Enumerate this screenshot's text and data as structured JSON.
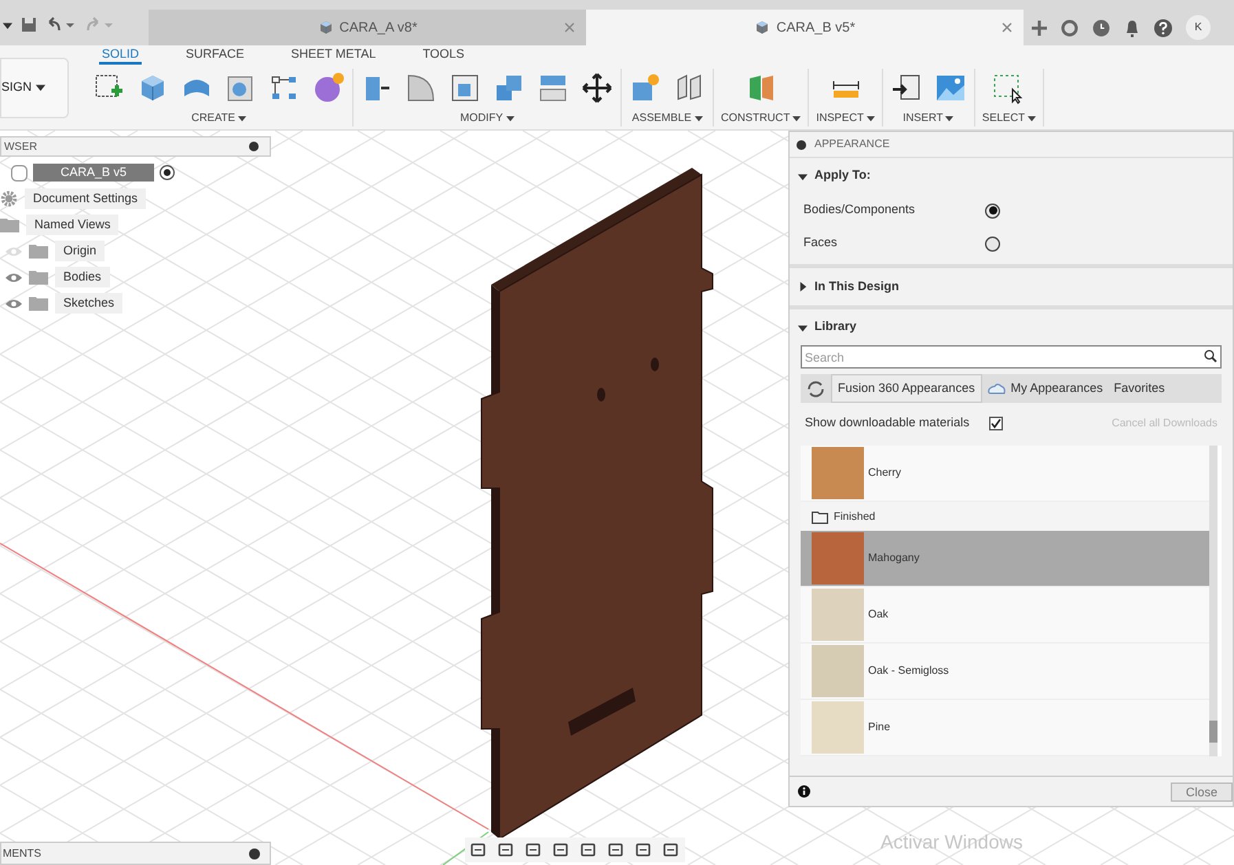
{
  "document_tabs": [
    {
      "label": "CARA_A v8*",
      "selected": false
    },
    {
      "label": "CARA_B v5*",
      "selected": true
    }
  ],
  "user_initials": "K",
  "workspace": "SIGN",
  "toolbar_tabs": [
    {
      "label": "SOLID",
      "selected": true
    },
    {
      "label": "SURFACE",
      "selected": false
    },
    {
      "label": "SHEET METAL",
      "selected": false
    },
    {
      "label": "TOOLS",
      "selected": false
    }
  ],
  "toolbar_groups": [
    "CREATE",
    "MODIFY",
    "ASSEMBLE",
    "CONSTRUCT",
    "INSPECT",
    "INSERT",
    "SELECT"
  ],
  "browser": {
    "title": "WSER",
    "items": [
      {
        "label": "CARA_B v5",
        "kind": "component",
        "selected": true,
        "children": [
          {
            "label": "Document Settings",
            "kind": "settings"
          },
          {
            "label": "Named Views",
            "kind": "folder"
          },
          {
            "label": "Origin",
            "kind": "folder",
            "visible": false
          },
          {
            "label": "Bodies",
            "kind": "folder",
            "visible": true
          },
          {
            "label": "Sketches",
            "kind": "folder",
            "visible": true
          }
        ]
      }
    ]
  },
  "appearance": {
    "title": "APPEARANCE",
    "apply_to": {
      "title": "Apply To:",
      "expanded": true,
      "options": [
        {
          "label": "Bodies/Components",
          "selected": true
        },
        {
          "label": "Faces",
          "selected": false
        }
      ]
    },
    "in_this_design": {
      "title": "In This Design",
      "expanded": false
    },
    "library": {
      "title": "Library",
      "expanded": true,
      "search": {
        "placeholder": "Search"
      },
      "tabs": [
        {
          "label": "Fusion 360 Appearances",
          "selected": true
        },
        {
          "label": "My Appearances",
          "selected": false
        },
        {
          "label": "Favorites",
          "selected": false
        }
      ],
      "show_downloadable": {
        "label": "Show downloadable materials",
        "checked": true
      },
      "cancel_downloads": {
        "label": "Cancel all Downloads",
        "disabled": true
      },
      "items": [
        {
          "kind": "material",
          "label": "Cherry",
          "color": "#c98a52",
          "selected": false
        },
        {
          "kind": "folder",
          "label": "Finished"
        },
        {
          "kind": "material",
          "label": "Mahogany",
          "color": "#b8643c",
          "selected": true
        },
        {
          "kind": "material",
          "label": "Oak",
          "color": "#ddd3bd",
          "selected": false
        },
        {
          "kind": "material",
          "label": "Oak - Semigloss",
          "color": "#d6ccb4",
          "selected": false
        },
        {
          "kind": "material",
          "label": "Pine",
          "color": "#e6dcc4",
          "selected": false
        }
      ]
    },
    "close_button": "Close"
  },
  "comments": {
    "title": "MENTS"
  },
  "activation_notice": "Activar Windows"
}
